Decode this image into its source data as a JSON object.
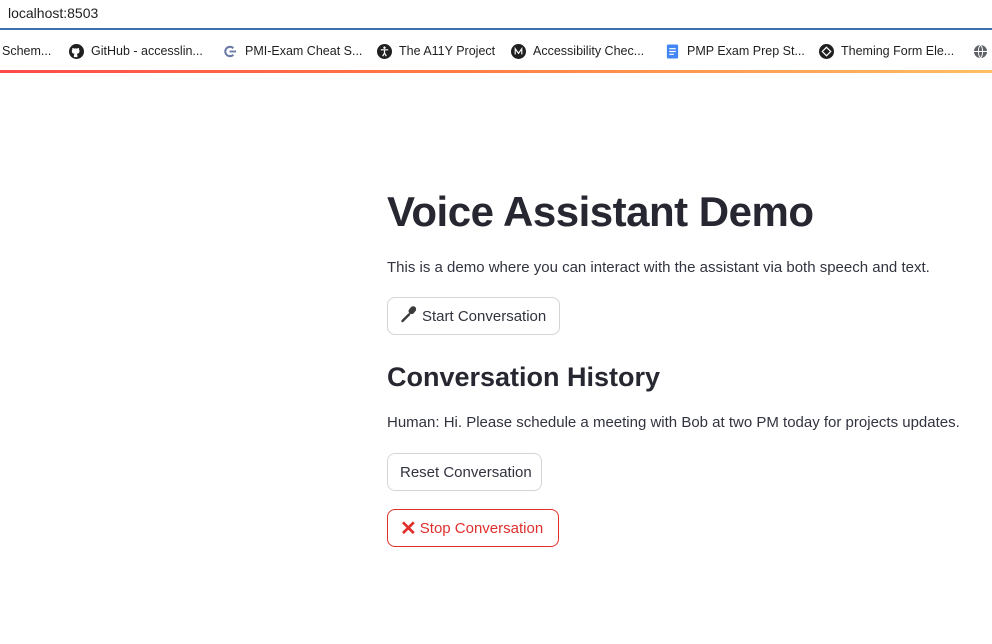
{
  "browser": {
    "url": "localhost:8503",
    "bookmarks": [
      {
        "label": "Schem...",
        "icon": "none"
      },
      {
        "label": "GitHub - accesslin...",
        "icon": "github-icon"
      },
      {
        "label": "PMI-Exam Cheat S...",
        "icon": "link-icon"
      },
      {
        "label": "The A11Y Project",
        "icon": "accessibility-icon"
      },
      {
        "label": "Accessibility Chec...",
        "icon": "medium-icon"
      },
      {
        "label": "PMP Exam Prep St...",
        "icon": "google-docs-icon"
      },
      {
        "label": "Theming Form Ele...",
        "icon": "codepen-icon"
      },
      {
        "label": "",
        "icon": "globe-icon"
      }
    ]
  },
  "app": {
    "title": "Voice Assistant Demo",
    "intro": "This is a demo where you can interact with the assistant via both speech and text.",
    "start_button": "Start Conversation",
    "start_icon": "microphone-icon",
    "history_heading": "Conversation History",
    "messages": [
      "Human: Hi. Please schedule a meeting with Bob at two PM today for projects updates."
    ],
    "reset_button": "Reset Conversation",
    "stop_button": "Stop Conversation",
    "stop_icon": "cross-mark-icon"
  },
  "colors": {
    "accent_red": "#e0302d",
    "heading": "#262730",
    "text": "#31333f",
    "url_underline": "#3a6fb0"
  }
}
